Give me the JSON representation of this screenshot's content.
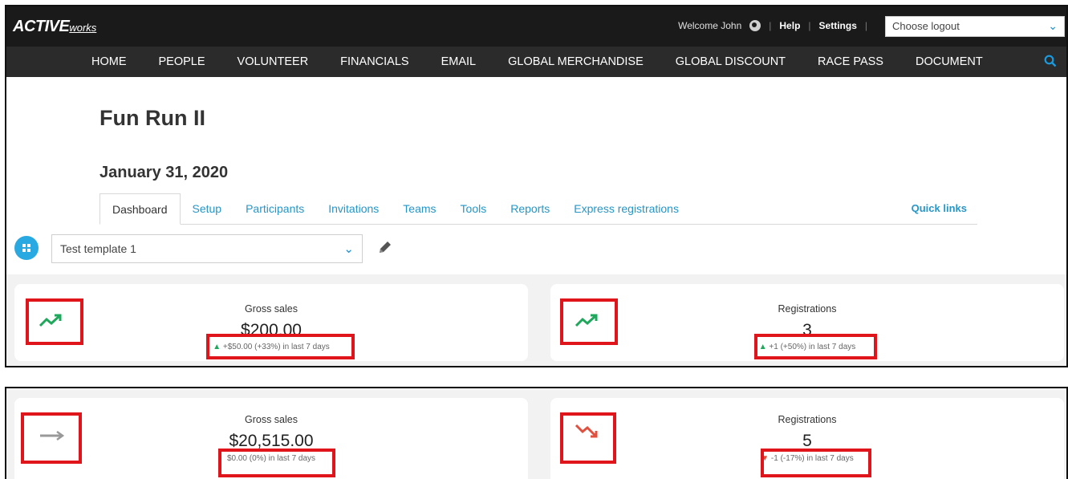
{
  "header": {
    "logo_main": "ACTIVE",
    "logo_sub": "works",
    "welcome": "Welcome John",
    "help": "Help",
    "settings": "Settings",
    "logout_select": "Choose logout"
  },
  "nav": [
    "HOME",
    "PEOPLE",
    "VOLUNTEER",
    "FINANCIALS",
    "EMAIL",
    "GLOBAL MERCHANDISE",
    "GLOBAL DISCOUNT",
    "RACE PASS",
    "DOCUMENT"
  ],
  "page": {
    "title": "Fun Run II",
    "date": "January 31, 2020"
  },
  "tabs": [
    "Dashboard",
    "Setup",
    "Participants",
    "Invitations",
    "Teams",
    "Tools",
    "Reports",
    "Express registrations"
  ],
  "quick_links": "Quick links",
  "template_select": "Test template 1",
  "cards_top": [
    {
      "label": "Gross sales",
      "value": "$200.00",
      "change": "+$50.00 (+33%) in last 7 days",
      "trend": "up"
    },
    {
      "label": "Registrations",
      "value": "3",
      "change": "+1 (+50%) in last 7 days",
      "trend": "up"
    }
  ],
  "cards_bottom": [
    {
      "label": "Gross sales",
      "value": "$20,515.00",
      "change": "$0.00 (0%) in last 7 days",
      "trend": "flat"
    },
    {
      "label": "Registrations",
      "value": "5",
      "change": "-1 (-17%) in last 7 days",
      "trend": "down"
    }
  ],
  "colors": {
    "accent": "#29a9e1",
    "link": "#2596c9",
    "up": "#1fa85c",
    "down": "#e0503f",
    "flat": "#999999",
    "highlight": "#e0141b"
  }
}
